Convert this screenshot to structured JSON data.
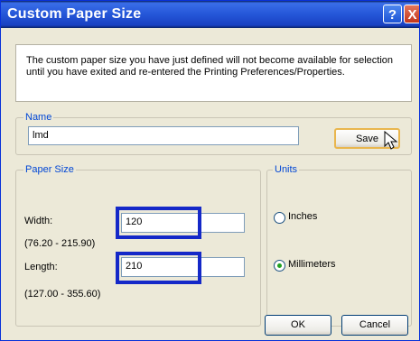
{
  "window": {
    "title": "Custom Paper Size",
    "help_label": "?",
    "close_label": "X"
  },
  "notice": {
    "line1": "The custom paper size you have just defined will not become available for selection",
    "line2": "until you have exited and re-entered the Printing Preferences/Properties."
  },
  "name_group": {
    "legend": "Name",
    "value": "lmd",
    "save_label": "Save"
  },
  "paper_size": {
    "legend": "Paper Size",
    "width_label": "Width:",
    "width_value": "120",
    "width_range": "(76.20 - 215.90)",
    "length_label": "Length:",
    "length_value": "210",
    "length_range": "(127.00 - 355.60)"
  },
  "units": {
    "legend": "Units",
    "options": [
      {
        "label": "Inches",
        "selected": false
      },
      {
        "label": "Millimeters",
        "selected": true
      }
    ]
  },
  "buttons": {
    "ok": "OK",
    "cancel": "Cancel"
  },
  "colors": {
    "title_bar": "#2456d8",
    "highlight": "#1428c8",
    "legend_text": "#0046d5",
    "dialog_bg": "#ece9d8"
  }
}
